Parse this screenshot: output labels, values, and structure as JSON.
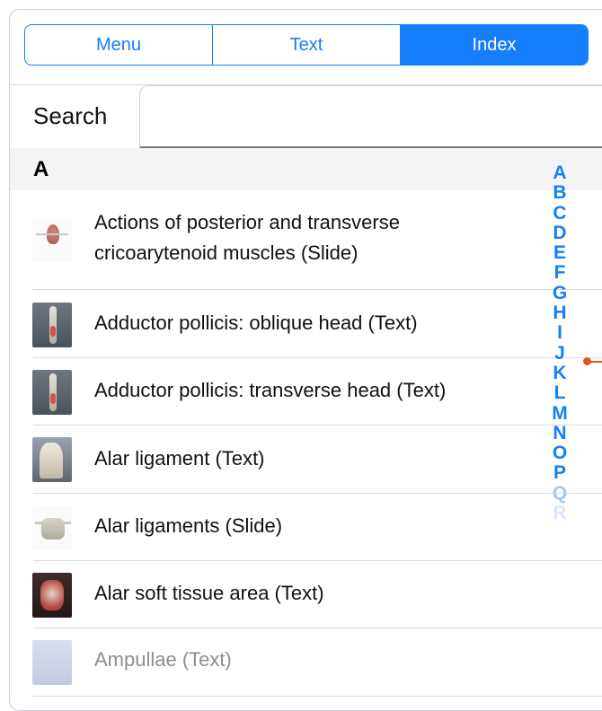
{
  "tabs": [
    {
      "label": "Menu",
      "active": false
    },
    {
      "label": "Text",
      "active": false
    },
    {
      "label": "Index",
      "active": true
    }
  ],
  "search": {
    "label": "Search",
    "value": ""
  },
  "section": {
    "letter": "A"
  },
  "items": [
    {
      "label": "Actions of posterior and transverse cricoarytenoid muscles (Slide)",
      "thumbnail": "larynx-thumbnail"
    },
    {
      "label": "Adductor pollicis: oblique head (Text)",
      "thumbnail": "arm-thumbnail"
    },
    {
      "label": "Adductor pollicis: transverse head (Text)",
      "thumbnail": "arm-thumbnail"
    },
    {
      "label": "Alar ligament (Text)",
      "thumbnail": "neck-thumbnail"
    },
    {
      "label": "Alar ligaments (Slide)",
      "thumbnail": "ligaments-thumbnail"
    },
    {
      "label": "Alar soft tissue area (Text)",
      "thumbnail": "soft-tissue-thumbnail"
    },
    {
      "label": "Ampullae (Text)",
      "thumbnail": "ampullae-thumbnail",
      "dimmed": true
    }
  ],
  "index_letters": [
    "A",
    "B",
    "C",
    "D",
    "E",
    "F",
    "G",
    "H",
    "I",
    "J",
    "K",
    "L",
    "M",
    "N",
    "O",
    "P",
    "Q",
    "R"
  ],
  "colors": {
    "accent": "#147efb",
    "marker": "#e0561e",
    "section_bg": "#f4f4f6",
    "dimmed_text": "#8e8e93"
  }
}
